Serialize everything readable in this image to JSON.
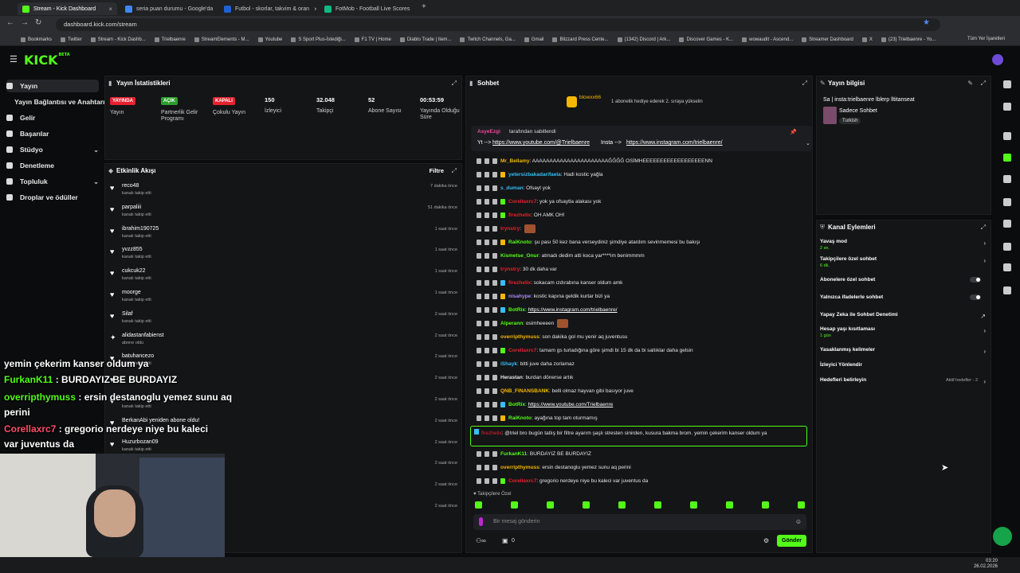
{
  "browser": {
    "tabs": [
      {
        "label": "Stream - Kick Dashboard",
        "color": "#53fc18",
        "active": true
      },
      {
        "label": "seria puan durumu - Google'da",
        "color": "#4285f4"
      },
      {
        "label": "Futbol - skorlar, takvim & oran",
        "color": "#1e60d6"
      },
      {
        "label": "FotMob - Football Live Scores",
        "color": "#10b981"
      }
    ],
    "new_tab": "+",
    "url": "dashboard.kick.com/stream",
    "bookmarks": [
      "Bookmarks",
      "Twitter",
      "Stream - Kick Dashb...",
      "Trielbaenre",
      "StreamElements - M...",
      "Youtube",
      "S Sport Plus-İstediği...",
      "F1 TV | Home",
      "Diablo Trade | Item...",
      "Twitch Channels, Ga...",
      "Gmail",
      "Blizzard Press Cente...",
      "(1342) Discord | Ark...",
      "Discover Games - K...",
      "wowaudit - Ascend...",
      "Streamer Dashboard",
      "X",
      "(23) Trielbaenre - Yo..."
    ],
    "all_bookmarks": "Tüm Yer İşaretleri"
  },
  "logo": {
    "text": "KICK",
    "beta": "BETA"
  },
  "sidebar": {
    "items": [
      {
        "label": "Yayın",
        "active": true
      },
      {
        "label": "Yayın Bağlantısı ve Anahtarı",
        "sub": true
      },
      {
        "label": "Gelir"
      },
      {
        "label": "Başarılar"
      },
      {
        "label": "Stüdyo",
        "chev": true
      },
      {
        "label": "Denetleme"
      },
      {
        "label": "Topluluk",
        "chev": true
      },
      {
        "label": "Droplar ve ödüller"
      }
    ]
  },
  "stats": {
    "title": "Yayın İstatistikleri",
    "items": [
      {
        "badge": "YAYINDA",
        "badge_color": "#e5222e",
        "label": "Yayın"
      },
      {
        "badge": "AÇIK",
        "badge_color": "#2e9e2e",
        "label": "Partnerlik Gelir Programı"
      },
      {
        "badge": "KAPALI",
        "badge_color": "#e5222e",
        "label": "Çokulu Yayın"
      },
      {
        "value": "150",
        "label": "İzleyici"
      },
      {
        "value": "32.048",
        "label": "Takipçi"
      },
      {
        "value": "52",
        "label": "Abone Sayısı"
      },
      {
        "value": "00:53:59",
        "label": "Yayında Olduğu Süre"
      }
    ]
  },
  "activity": {
    "title": "Etkinlik Akışı",
    "filter": "Filtre",
    "items": [
      {
        "user": "reco48",
        "sub": "kanalı takip etti",
        "time": "7 dakika önce"
      },
      {
        "user": "parpaliii",
        "sub": "kanalı takip etti",
        "time": "51 dakika önce"
      },
      {
        "user": "ibrahim190725",
        "sub": "kanalı takip etti",
        "time": "1 saat önce"
      },
      {
        "user": "yvzz855",
        "sub": "kanalı takip etti",
        "time": "1 saat önce"
      },
      {
        "user": "cukcuk22",
        "sub": "kanalı takip etti",
        "time": "1 saat önce"
      },
      {
        "user": "moorge",
        "sub": "kanalı takip etti",
        "time": "1 saat önce"
      },
      {
        "user": "Silaf",
        "sub": "kanalı takip etti",
        "time": "2 saat önce"
      },
      {
        "user": "alidastanfabienst",
        "sub": "abone oldu",
        "time": "2 saat önce"
      },
      {
        "user": "batuhancezo",
        "sub": "kanalı takip etti",
        "time": "2 saat önce"
      },
      {
        "user": "",
        "sub": "",
        "time": "2 saat önce"
      },
      {
        "user": "",
        "sub": "kanalı takip etti",
        "time": "2 saat önce"
      },
      {
        "user": "BerkanAbi yeniden abone oldu!",
        "sub": "",
        "time": "2 saat önce"
      },
      {
        "user": "Huzurbozan09",
        "sub": "kanalı takip etti",
        "time": "2 saat önce"
      },
      {
        "user": "",
        "sub": "",
        "time": "2 saat önce"
      },
      {
        "user": "",
        "sub": "",
        "time": "2 saat önce"
      },
      {
        "user": "",
        "sub": "",
        "time": "2 saat önce"
      }
    ]
  },
  "chat": {
    "title": "Sohbet",
    "gift_user": "blowxx66",
    "gift_text": "1 abonelik hediye ederek 2. sıraya yükselin",
    "pinned_by": "AsyeEzgi",
    "pinned_suffix": "tarafından sabitlendi",
    "pinned_text_1": "Yt -->",
    "pinned_link_1": "https://www.youtube.com/@Trielbaenre",
    "pinned_text_2": "Insta -->",
    "pinned_link_2": "https://www.instagram.com/trielbaenre/",
    "messages": [
      {
        "user": "Mr_Bellamy",
        "color": "#f5b700",
        "text": ": AAAAAAAAAAAAAAAAAAAAAAĞĞĞĞ OSİMHEEEEEEEEEEEEEEEEEENN",
        "icon": ""
      },
      {
        "user": "yetersizbakadarifaela",
        "color": "#38bdf8",
        "text": ": Hadi kostic yağla",
        "icon": "gold"
      },
      {
        "user": "s_duman",
        "color": "#38bdf8",
        "text": ": Ofsayt yok",
        "icon": ""
      },
      {
        "user": "Corellaxrc7",
        "color": "#e5222e",
        "text": ": yok ya ofsaytla alakası yok",
        "icon": "green"
      },
      {
        "user": "firezhelix",
        "color": "#e5222e",
        "text": ": OH AMK OH!",
        "icon": "green"
      },
      {
        "user": "trynstry",
        "color": "#e5222e",
        "text": ":",
        "icon": "",
        "emote": true
      },
      {
        "user": "RaiKnoto",
        "color": "#53fc18",
        "text": ": şu pası 50 kez bana verseydiniz şimdiye atardım sevinmemesi bu bakışı",
        "icon": "gold"
      },
      {
        "user": "Kismetse_Onur",
        "color": "#53fc18",
        "text": ": atmadı dedim atti koca yar****im benimmmm",
        "icon": ""
      },
      {
        "user": "trynstry",
        "color": "#e5222e",
        "text": ": 30 dk daha var",
        "icon": ""
      },
      {
        "user": "firezhelix",
        "color": "#e5222e",
        "text": ": sokacam ızdırabına kanser oldum amk",
        "icon": "cyan"
      },
      {
        "user": "nisahype",
        "color": "#a78bfa",
        "text": ": kostic kapına geldik kurtar bizi ya",
        "icon": "gold"
      },
      {
        "user": "BotRix",
        "color": "#53fc18",
        "text": ": ",
        "link": "https://www.instagram.com/trielbaenre/",
        "icon": "cyan"
      },
      {
        "user": "Alperann",
        "color": "#53fc18",
        "text": ": osimheeeen",
        "icon": "",
        "emote": true
      },
      {
        "user": "overripthymuss",
        "color": "#f5b700",
        "text": ": son dakika gol mu yenir aq juventusu",
        "icon": ""
      },
      {
        "user": "Corellaxrc7",
        "color": "#e5222e",
        "text": ": tamam gs turladığına göre şimdi bi 15 dk da bi saltıklar daha gelsin",
        "icon": "green"
      },
      {
        "user": "iShayk",
        "color": "#38bdf8",
        "text": ": bitti juve daha zorlamaz",
        "icon": ""
      },
      {
        "user": "Herastan",
        "color": "#e6e6e6",
        "text": ": burdan dönerse artık",
        "icon": ""
      },
      {
        "user": "QNB_FINANSBANK",
        "color": "#f5b700",
        "text": ": belli olmaz hayvan gibi basıyor juve",
        "icon": ""
      },
      {
        "user": "BotRix",
        "color": "#53fc18",
        "text": ": ",
        "link": "https://www.youtube.com/Trielbaenre",
        "icon": "cyan"
      },
      {
        "user": "RaiKnoto",
        "color": "#53fc18",
        "text": ": ayağına top tam oturmamış",
        "icon": "gold"
      }
    ],
    "highlight": {
      "user": "firezhelix",
      "color": "#e5222e",
      "text": ": @triel bro bugün tatlış bir filtre ayarım şaşlı stresten sinirden, kusura bakma brom. yemin çekerim kanser oldum ya"
    },
    "after": [
      {
        "user": "FurkanK11",
        "color": "#53fc18",
        "text": ": BURDAYIZ BE BURDAYIZ",
        "icon": ""
      },
      {
        "user": "overripthymuss",
        "color": "#f5b700",
        "text": ": ersin destanoglu yemez sunu aq perini",
        "icon": ""
      },
      {
        "user": "Corellaxrc7",
        "color": "#e5222e",
        "text": ": gregorio nerdeye niye bu kaleci var juventus da",
        "icon": "green"
      }
    ],
    "followers_only": "Takipçilere Özel",
    "input_placeholder": "Bir mesaj gönderin",
    "send": "Gönder",
    "counter": "0"
  },
  "info": {
    "title": "Yayın bilgisi",
    "stream_title": "Sa | insta:trielbaenre lblerp lltitanseat",
    "category": "Sadece Sohbet",
    "tag": "Turkish"
  },
  "channel_actions": {
    "title": "Kanal Eylemleri",
    "items": [
      {
        "label": "Yavaş mod",
        "sub": "2 sn.",
        "type": "chev"
      },
      {
        "label": "Takipçilere özel sohbet",
        "sub": "6 dk.",
        "type": "chev"
      },
      {
        "label": "Abonelere özel sohbet",
        "type": "toggle"
      },
      {
        "label": "Yalnızca ifadelerle sohbet",
        "type": "toggle"
      },
      {
        "label": "Yapay Zeka ile Sohbet Denetimi",
        "type": "ext"
      },
      {
        "label": "Hesap yaşı kısıtlaması",
        "sub": "1 gün",
        "type": "chev"
      },
      {
        "label": "Yasaklanmış kelimeler",
        "type": "chev"
      },
      {
        "label": "İzleyici Yönlendir",
        "type": "none"
      },
      {
        "label": "Hedefleri belirleyin",
        "type": "chev",
        "right": "Aktif hedefler - 2"
      }
    ]
  },
  "overlay": {
    "lines": [
      {
        "name": "",
        "text": "yemin çekerim kanser oldum ya"
      },
      {
        "name": "FurkanK11",
        "text": " : BURDAYIZ BE BURDAYIZ"
      },
      {
        "name": "overripthymuss",
        "text": " : ersin destanoglu yemez sunu aq"
      },
      {
        "name": "",
        "text": "perini"
      },
      {
        "name": "Corellaxrc7",
        "text": " : gregorio nerdeye niye bu kaleci",
        "red": true
      },
      {
        "name": "",
        "text": "var juventus da"
      }
    ]
  },
  "taskbar": {
    "time": "03:20",
    "date": "26.02.2026"
  },
  "colors": {
    "accent": "#53fc18",
    "bg": "#0b0c0d",
    "panel": "#141517"
  }
}
